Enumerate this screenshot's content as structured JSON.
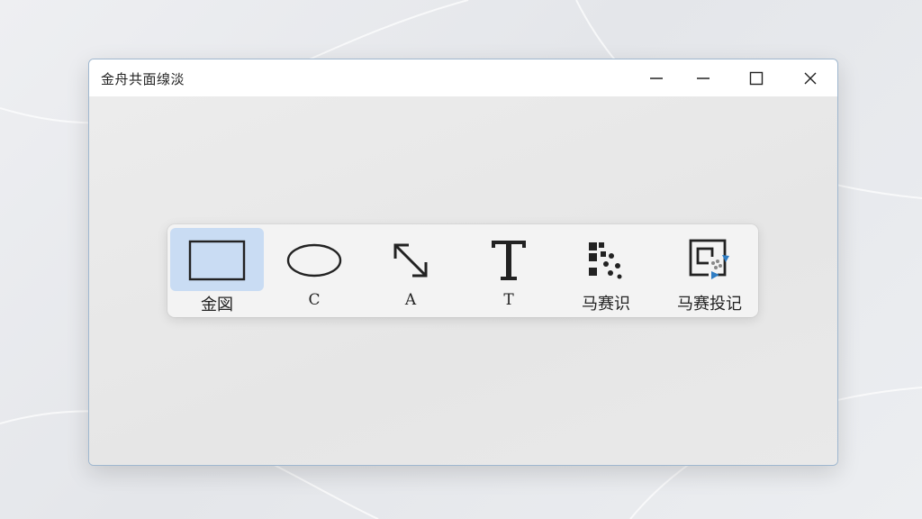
{
  "window": {
    "title": "金舟共面缐淡"
  },
  "toolbar": {
    "tools": [
      {
        "id": "rectangle",
        "label": "金図",
        "selected": true
      },
      {
        "id": "ellipse",
        "label": "C",
        "selected": false
      },
      {
        "id": "arrow",
        "label": "A",
        "selected": false
      },
      {
        "id": "text",
        "label": "T",
        "selected": false
      },
      {
        "id": "mosaic",
        "label": "马赛识",
        "selected": false
      },
      {
        "id": "mosaic-erase",
        "label": "马赛投记",
        "selected": false
      }
    ]
  },
  "colors": {
    "selected_bg": "#c9dcf3",
    "accent_blue": "#2f7dc4",
    "icon_dark": "#222222"
  }
}
